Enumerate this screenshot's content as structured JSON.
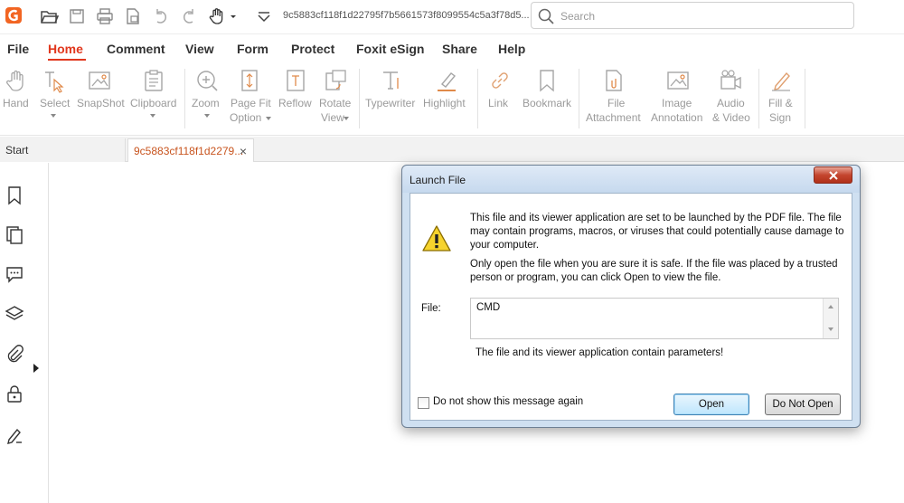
{
  "titlebar": {
    "file_name": "9c5883cf118f1d22795f7b5661573f8099554c5a3f78d5...",
    "search_placeholder": "Search"
  },
  "menu": [
    {
      "label": "File"
    },
    {
      "label": "Home",
      "active": true
    },
    {
      "label": "Comment"
    },
    {
      "label": "View"
    },
    {
      "label": "Form"
    },
    {
      "label": "Protect"
    },
    {
      "label": "Foxit eSign"
    },
    {
      "label": "Share"
    },
    {
      "label": "Help"
    }
  ],
  "ribbon": {
    "hand": "Hand",
    "select": "Select",
    "snapshot": "SnapShot",
    "clipboard": "Clipboard",
    "zoom": "Zoom",
    "page_fit_1": "Page Fit",
    "page_fit_2": "Option",
    "reflow": "Reflow",
    "rotate_1": "Rotate",
    "rotate_2": "View",
    "typewriter": "Typewriter",
    "highlight": "Highlight",
    "link": "Link",
    "bookmark": "Bookmark",
    "file_att_1": "File",
    "file_att_2": "Attachment",
    "image_ann_1": "Image",
    "image_ann_2": "Annotation",
    "audio_1": "Audio",
    "audio_2": "& Video",
    "fill_1": "Fill &",
    "fill_2": "Sign"
  },
  "tabs": {
    "start": "Start",
    "document": "9c5883cf118f1d2279...",
    "close": "×"
  },
  "dialog": {
    "title": "Launch File",
    "message1": "This file and its viewer application are set to be launched by the PDF file. The file may contain programs, macros, or viruses that could potentially cause damage to your computer.",
    "message2": "Only open the file when you are sure it is safe. If the file was placed by a trusted person or program, you can click Open to view the file.",
    "file_label": "File:",
    "file_value": "CMD",
    "params_note": "The file and its viewer application contain parameters!",
    "checkbox_label": "Do not show this message again",
    "checkbox_checked": false,
    "open_button": "Open",
    "do_not_open_button": "Do Not Open"
  },
  "colors": {
    "accent": "#e1371d",
    "active_tab_text": "#c8541e",
    "logo": "#f26522"
  }
}
